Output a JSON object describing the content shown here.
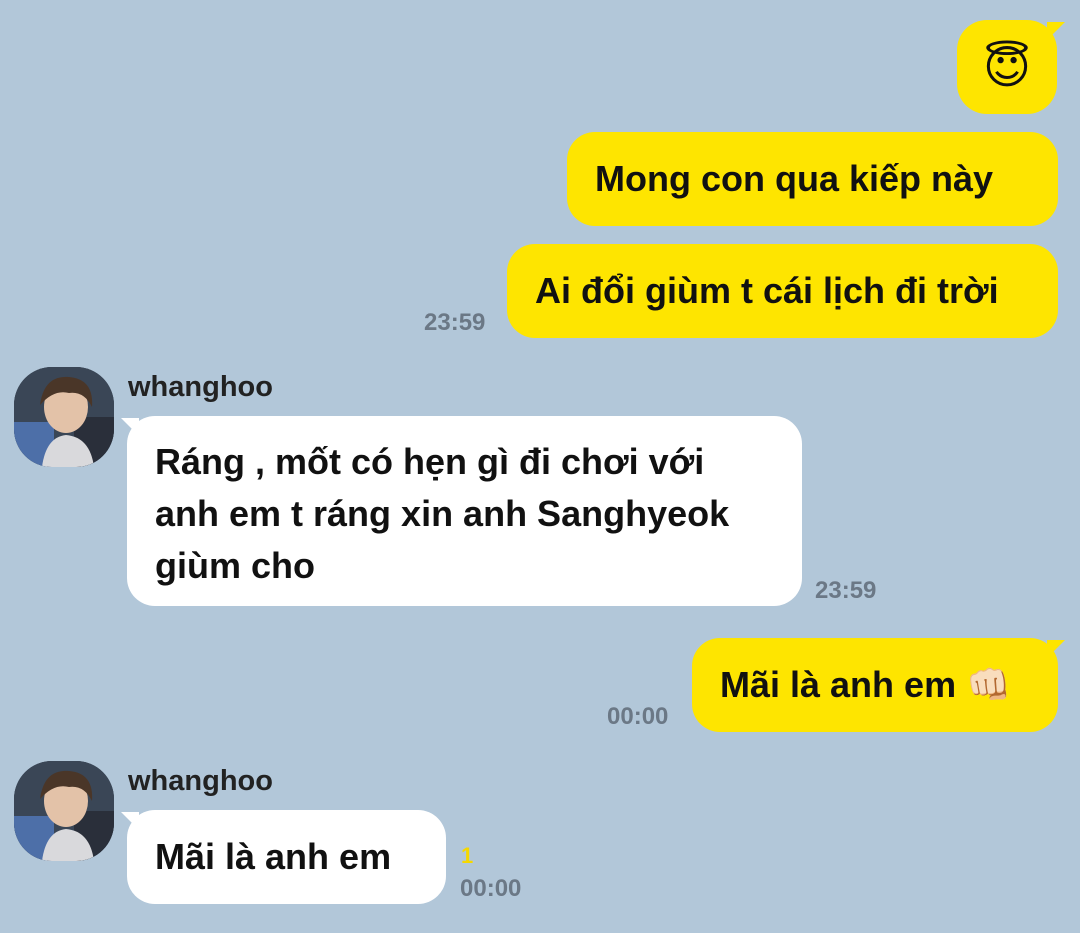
{
  "messages": [
    {
      "side": "out",
      "text": "😇"
    },
    {
      "side": "out",
      "text": "Mong con qua kiếp này"
    },
    {
      "side": "out",
      "text": "Ai đổi giùm t cái lịch đi trời",
      "time": "23:59"
    },
    {
      "side": "in",
      "sender": "whanghoo",
      "lines": [
        "Ráng , mốt có hẹn gì đi chơi với",
        "anh em t ráng xin anh Sanghyeok",
        "giùm cho"
      ],
      "time": "23:59"
    },
    {
      "side": "out",
      "text": "Mãi là anh em 👊🏻",
      "time": "00:00"
    },
    {
      "side": "in",
      "sender": "whanghoo",
      "text": "Mãi là anh em",
      "unread": "1",
      "time": "00:00"
    }
  ],
  "colors": {
    "background": "#b2c7d9",
    "outgoing_bubble": "#fee500",
    "incoming_bubble": "#ffffff",
    "timestamp": "#6b7886",
    "unread_count": "#f5d800"
  }
}
